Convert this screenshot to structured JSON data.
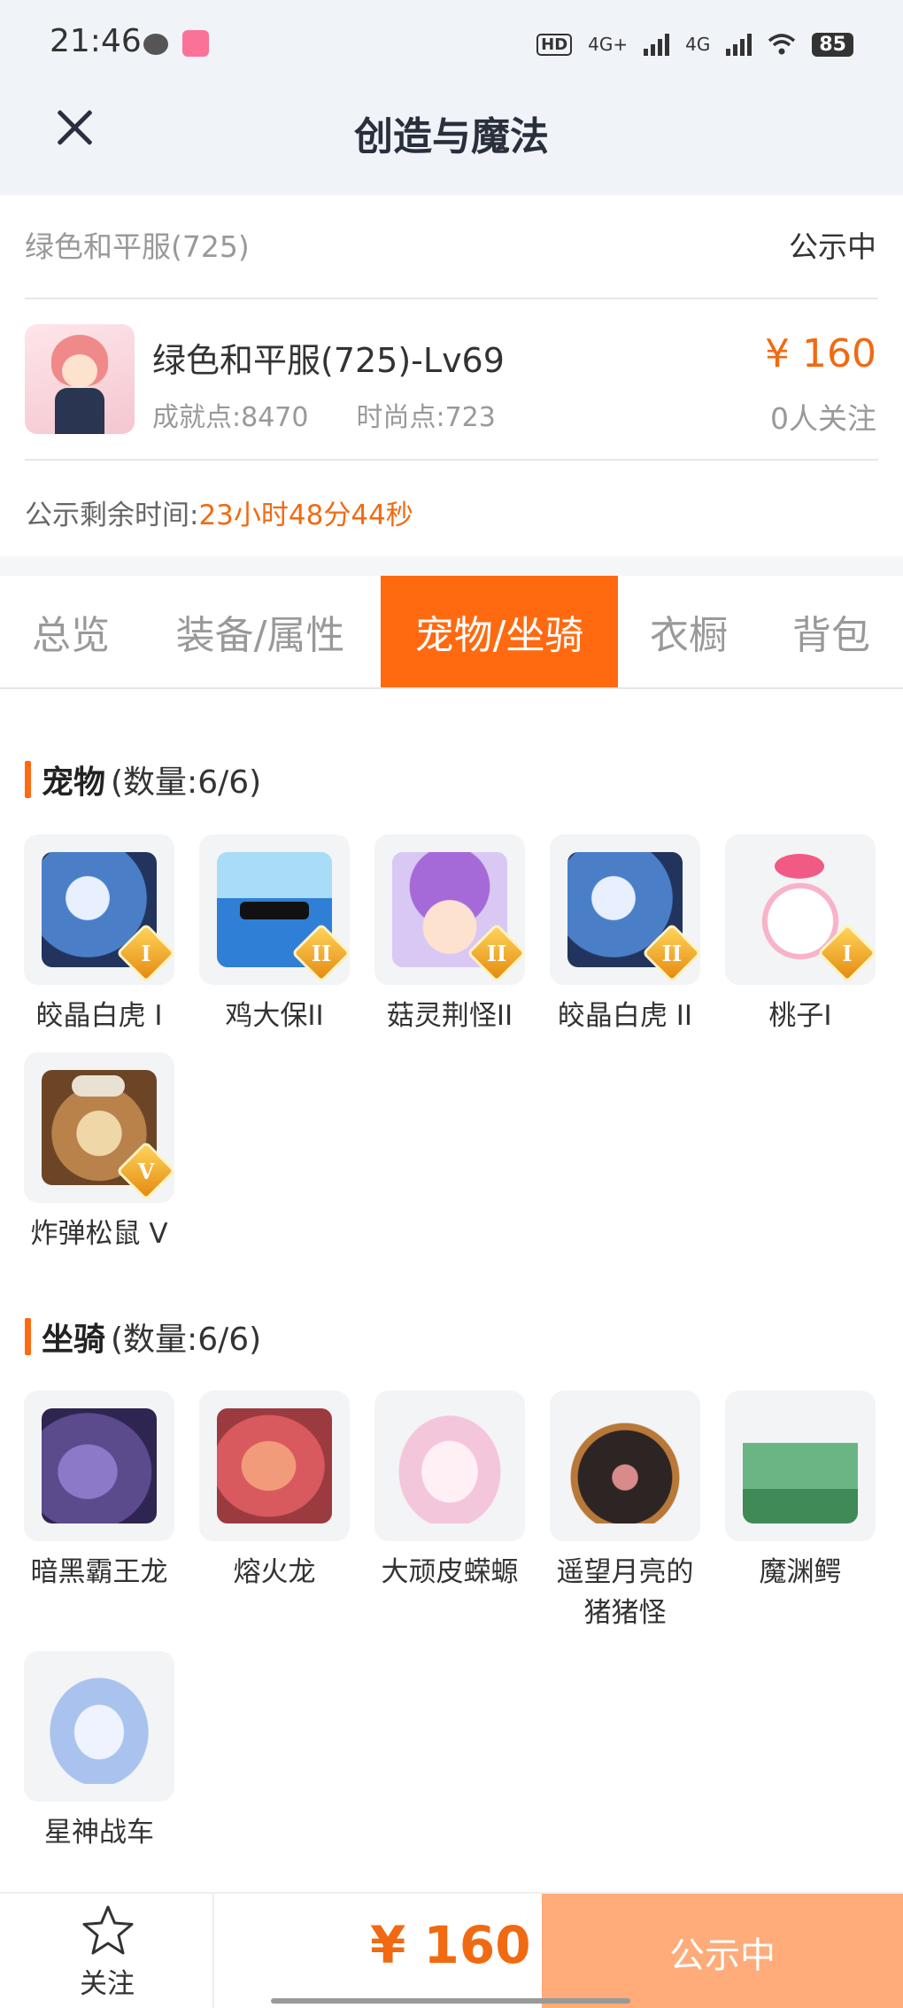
{
  "status_bar": {
    "time": "21:46",
    "hd": "HD",
    "net1": "4G+",
    "net2": "4G",
    "battery": "85"
  },
  "header": {
    "title": "创造与魔法"
  },
  "listing": {
    "name": "绿色和平服(725)",
    "status": "公示中",
    "char_title": "绿色和平服(725)-Lv69",
    "achievement": "成就点:8470",
    "fashion": "时尚点:723",
    "price": "¥ 160",
    "followers": "0人关注",
    "remain_label": "公示剩余时间:",
    "remain_value": "23小时48分44秒"
  },
  "tabs": [
    {
      "label": "总览",
      "active": false
    },
    {
      "label": "装备/属性",
      "active": false
    },
    {
      "label": "宠物/坐骑",
      "active": true
    },
    {
      "label": "衣橱",
      "active": false
    },
    {
      "label": "背包",
      "active": false
    }
  ],
  "pets": {
    "title": "宠物",
    "count": "(数量:6/6)",
    "items": [
      {
        "name": "皎晶白虎 I",
        "badge": "I",
        "color": "#4a7fc8"
      },
      {
        "name": "鸡大保II",
        "badge": "II",
        "color": "#2f7fd6"
      },
      {
        "name": "菇灵荆怪II",
        "badge": "II",
        "color": "#a56ad8"
      },
      {
        "name": "皎晶白虎 II",
        "badge": "II",
        "color": "#4a7fc8"
      },
      {
        "name": "桃子I",
        "badge": "I",
        "color": "#f7b3c8"
      },
      {
        "name": "炸弹松鼠 V",
        "badge": "V",
        "color": "#b9824a"
      }
    ]
  },
  "mounts": {
    "title": "坐骑",
    "count": "(数量:6/6)",
    "items": [
      {
        "name": "暗黑霸王龙",
        "color": "#5b4a8c"
      },
      {
        "name": "熔火龙",
        "color": "#d8595e"
      },
      {
        "name": "大顽皮蝾螈",
        "color": "#f4c6dc"
      },
      {
        "name": "遥望月亮的猪猪怪",
        "color": "#2d2424"
      },
      {
        "name": "魔渊鳄",
        "color": "#3f8a57"
      },
      {
        "name": "星神战车",
        "color": "#a9c3ee"
      }
    ]
  },
  "bottom_bar": {
    "follow_label": "关注",
    "price": "¥ 160",
    "action_label": "公示中"
  },
  "colors": {
    "accent": "#ff6a11",
    "price": "#f06a12",
    "action_bg": "#ffab7a"
  },
  "icons": [
    "close-icon",
    "star-icon",
    "wechat-icon",
    "bilibili-icon",
    "wifi-icon",
    "signal-icon",
    "battery-icon"
  ]
}
